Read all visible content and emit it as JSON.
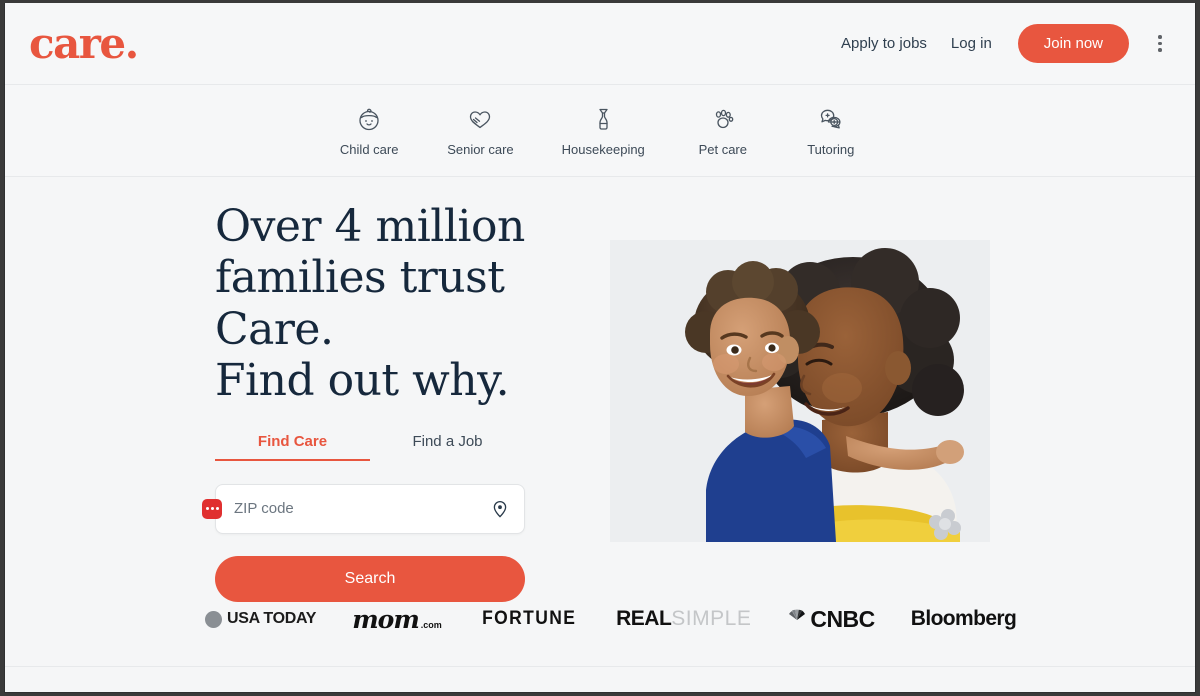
{
  "header": {
    "logo_text": "care",
    "logo_dot": ".",
    "apply_label": "Apply to jobs",
    "login_label": "Log in",
    "join_label": "Join now",
    "kebab_icon": "more-vertical-icon",
    "brand_color": "#e8563f"
  },
  "categories": [
    {
      "label": "Child care",
      "icon": "baby-face-icon"
    },
    {
      "label": "Senior care",
      "icon": "heart-hands-icon"
    },
    {
      "label": "Housekeeping",
      "icon": "spray-bottle-icon"
    },
    {
      "label": "Pet care",
      "icon": "paw-print-icon"
    },
    {
      "label": "Tutoring",
      "icon": "speech-bubbles-icon"
    }
  ],
  "hero": {
    "headline_line1": "Over 4 million",
    "headline_line2": "families trust",
    "headline_line3": "Care.",
    "headline_line4": "Find out why.",
    "headline_color": "#16283c",
    "tabs": [
      {
        "label": "Find Care",
        "active": true
      },
      {
        "label": "Find a Job",
        "active": false
      }
    ],
    "zip_placeholder": "ZIP code",
    "zip_value": "",
    "autofill_icon": "password-manager-icon",
    "pin_icon": "location-pin-icon",
    "search_label": "Search",
    "photo_alt": "woman carrying smiling child on her back"
  },
  "press": {
    "usatoday": "USA TODAY",
    "mom": "mom",
    "mom_suffix": ".com",
    "fortune": "FORTUNE",
    "real": "REAL",
    "simple": "SIMPLE",
    "cnbc": "CNBC",
    "bloomberg": "Bloomberg"
  }
}
